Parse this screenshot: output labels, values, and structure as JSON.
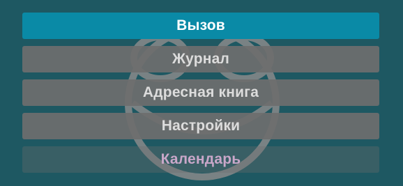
{
  "menu": {
    "items": [
      {
        "label": "Вызов",
        "state": "selected"
      },
      {
        "label": "Журнал",
        "state": "normal"
      },
      {
        "label": "Адресная книга",
        "state": "normal"
      },
      {
        "label": "Настройки",
        "state": "normal"
      },
      {
        "label": "Календарь",
        "state": "partially-visible"
      }
    ]
  },
  "colors": {
    "background": "#1e5862",
    "selected": "#0a8aa6",
    "item": "#6e6e6e",
    "last_item_text": "#c9a7c9"
  },
  "icons": {
    "background": "watermark-emblem-icon"
  }
}
